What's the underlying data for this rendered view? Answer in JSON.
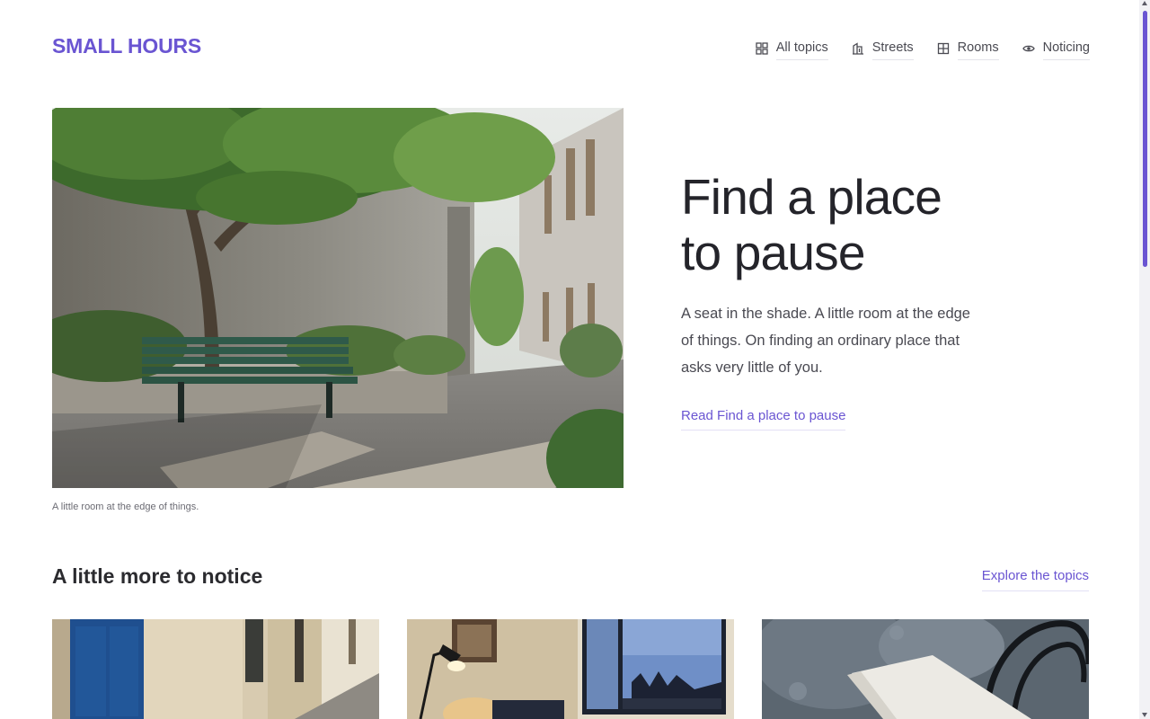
{
  "site": {
    "logo": "SMALL HOURS",
    "accent_color": "#6a55d2"
  },
  "nav": {
    "items": [
      {
        "label": "All topics",
        "icon": "grid-icon"
      },
      {
        "label": "Streets",
        "icon": "building-icon"
      },
      {
        "label": "Rooms",
        "icon": "window-icon"
      },
      {
        "label": "Noticing",
        "icon": "eye-icon"
      }
    ]
  },
  "hero": {
    "image": "bench-courtyard-photo",
    "caption": "A little room at the edge of things.",
    "title_line1": "Find a place",
    "title_line2": "to pause",
    "excerpt": "A seat in the shade. A little room at the edge of things. On finding an ordinary place that asks very little of you.",
    "link": "Read Find a place to pause"
  },
  "section": {
    "title": "A little more to notice",
    "link": "Explore the topics"
  },
  "cards": [
    {
      "image": "blue-door-street-photo"
    },
    {
      "image": "lamp-room-window-photo"
    },
    {
      "image": "chair-notebook-photo"
    }
  ]
}
